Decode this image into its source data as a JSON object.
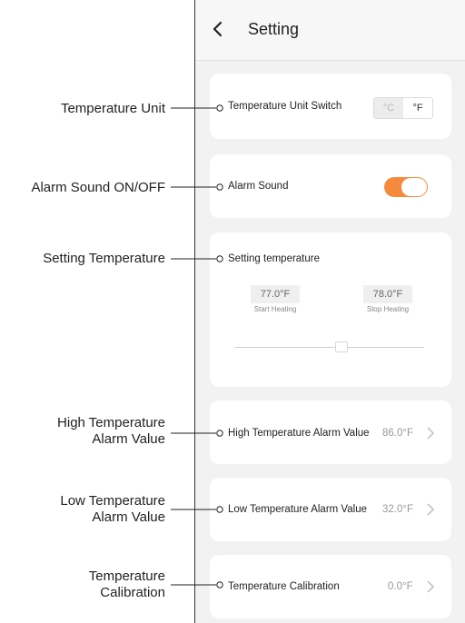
{
  "header": {
    "title": "Setting"
  },
  "annotations": {
    "unit": "Temperature Unit",
    "alarm_sound": "Alarm Sound ON/OFF",
    "setting_temp": "Setting Temperature",
    "high_line1": "High Temperature",
    "high_line2": "Alarm Value",
    "low_line1": "Low Temperature",
    "low_line2": "Alarm Value",
    "calib_line1": "Temperature",
    "calib_line2": "Calibration"
  },
  "unit_card": {
    "label": "Temperature Unit Switch",
    "celsius": "°C",
    "fahrenheit": "°F",
    "selected": "°F"
  },
  "alarm_card": {
    "label": "Alarm Sound",
    "on": true
  },
  "setting_card": {
    "label": "Setting temperature",
    "start_value": "77.0°F",
    "start_caption": "Start Heating",
    "stop_value": "78.0°F",
    "stop_caption": "Stop Heating"
  },
  "high_card": {
    "label": "High Temperature Alarm Value",
    "value": "86.0°F"
  },
  "low_card": {
    "label": "Low Temperature Alarm Value",
    "value": "32.0°F"
  },
  "calib_card": {
    "label": "Temperature Calibration",
    "value": "0.0°F"
  },
  "colors": {
    "accent": "#f58a3c",
    "background": "#f2f2f2",
    "card": "#ffffff"
  }
}
